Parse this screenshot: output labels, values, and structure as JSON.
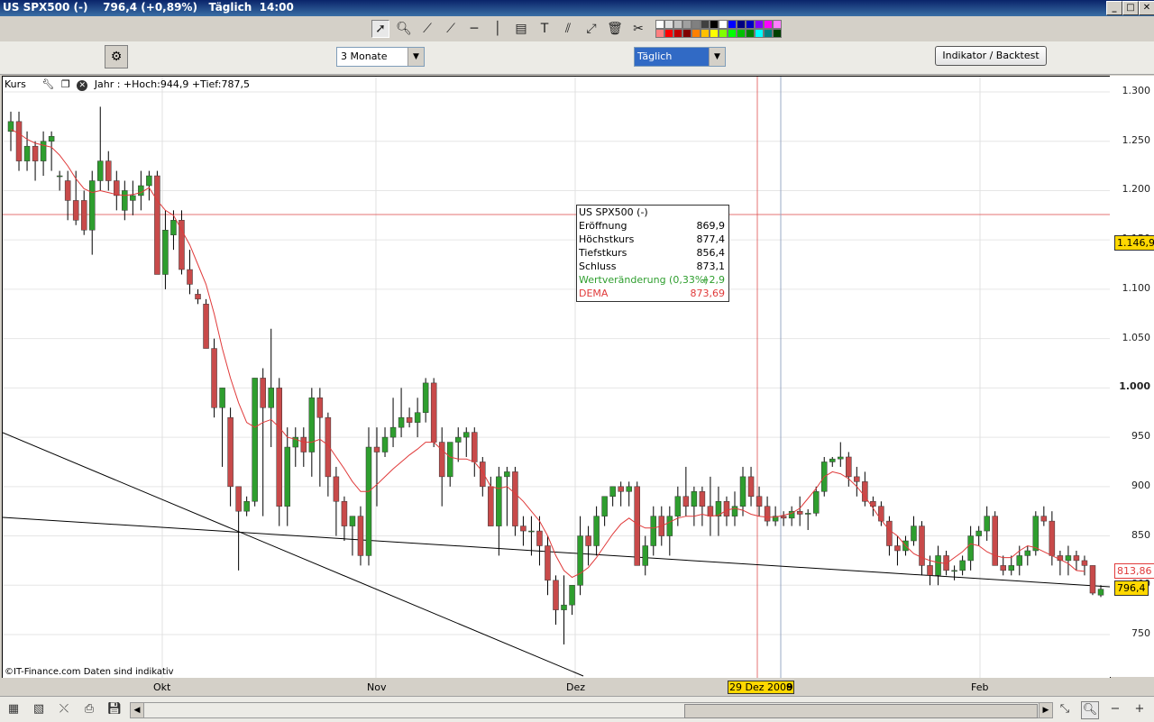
{
  "window": {
    "title": "US SPX500 (-)    796,4 (+0,89%)   Täglich  14:00"
  },
  "toolbar": {
    "icons": [
      "pointer-icon",
      "zoom-cursor-icon",
      "line-tool-icon",
      "trendline-icon",
      "horizontal-line-icon",
      "vertical-line-icon",
      "channel-icon",
      "text-tool-icon",
      "parallel-icon",
      "fibonacci-icon",
      "trash-icon",
      "tools-icon"
    ],
    "colors_row1": [
      "#ffffff",
      "#e0e0e0",
      "#c0c0c0",
      "#a0a0a0",
      "#808080",
      "#404040",
      "#000000",
      "#ffffff",
      "#0000ff",
      "#000080",
      "#0000c0",
      "#8000ff",
      "#ff00ff",
      "#ff80ff"
    ],
    "colors_row2": [
      "#ff8080",
      "#ff0000",
      "#c00000",
      "#800000",
      "#ff8000",
      "#ffc000",
      "#ffff00",
      "#80ff00",
      "#00ff00",
      "#00c000",
      "#008000",
      "#00ffff",
      "#008080",
      "#004000"
    ]
  },
  "controls": {
    "period": "3 Monate",
    "interval": "Täglich",
    "indicator_button": "Indikator / Backtest"
  },
  "chart_header": {
    "label": "Kurs",
    "range": "Jahr : +Hoch:944,9 +Tief:787,5"
  },
  "copyright": "©IT-Finance.com  Daten sind indikativ",
  "info": {
    "title": "US SPX500 (-)",
    "rows": [
      {
        "k": "Eröffnung",
        "v": "869,9"
      },
      {
        "k": "Höchstkurs",
        "v": "877,4"
      },
      {
        "k": "Tiefstkurs",
        "v": "856,4"
      },
      {
        "k": "Schluss",
        "v": "873,1"
      },
      {
        "k": "Wertveränderung (0,33%)",
        "v": "+2,9"
      },
      {
        "k": "DEMA",
        "v": "873,69"
      }
    ]
  },
  "axis": {
    "ticks": [
      "1.300",
      "1.250",
      "1.200",
      "1.150",
      "1.100",
      "1.050",
      "1.000",
      "950",
      "900",
      "850",
      "800",
      "750"
    ],
    "crosshair_value": "1.146,9",
    "dema_value": "813,86",
    "last_value": "796,4"
  },
  "x_axis": {
    "labels": [
      "Okt",
      "Nov",
      "Dez",
      "Feb"
    ],
    "cursor_date": "29 Dez 2008",
    "cursor_suffix": "9"
  },
  "chart_data": {
    "type": "candlestick",
    "ylim": [
      730,
      1310
    ],
    "colors": {
      "up": "#2e9e2e",
      "down": "#c84a4a",
      "dema": "#e03a3a",
      "crosshair": "#e05050",
      "yellow": "#ffd800"
    },
    "candles": [
      [
        1260,
        1280,
        1240,
        1270
      ],
      [
        1270,
        1280,
        1220,
        1230
      ],
      [
        1230,
        1260,
        1220,
        1245
      ],
      [
        1245,
        1250,
        1210,
        1230
      ],
      [
        1230,
        1260,
        1215,
        1250
      ],
      [
        1250,
        1260,
        1220,
        1255
      ],
      [
        1215,
        1220,
        1200,
        1215
      ],
      [
        1210,
        1220,
        1170,
        1190
      ],
      [
        1190,
        1220,
        1165,
        1170
      ],
      [
        1190,
        1200,
        1155,
        1160
      ],
      [
        1160,
        1220,
        1135,
        1210
      ],
      [
        1210,
        1285,
        1200,
        1230
      ],
      [
        1230,
        1240,
        1200,
        1210
      ],
      [
        1210,
        1220,
        1180,
        1195
      ],
      [
        1180,
        1210,
        1170,
        1200
      ],
      [
        1190,
        1210,
        1175,
        1195
      ],
      [
        1195,
        1220,
        1180,
        1205
      ],
      [
        1205,
        1220,
        1190,
        1215
      ],
      [
        1215,
        1220,
        1120,
        1115
      ],
      [
        1115,
        1180,
        1100,
        1160
      ],
      [
        1155,
        1180,
        1140,
        1170
      ],
      [
        1170,
        1180,
        1115,
        1120
      ],
      [
        1120,
        1140,
        1095,
        1105
      ],
      [
        1095,
        1100,
        1085,
        1090
      ],
      [
        1085,
        1090,
        1040,
        1040
      ],
      [
        1040,
        1050,
        970,
        980
      ],
      [
        980,
        1000,
        920,
        1000
      ],
      [
        970,
        980,
        880,
        900
      ],
      [
        900,
        890,
        815,
        875
      ],
      [
        875,
        890,
        870,
        885
      ],
      [
        885,
        1010,
        880,
        1010
      ],
      [
        1010,
        1020,
        870,
        980
      ],
      [
        980,
        1060,
        940,
        1000
      ],
      [
        1000,
        1010,
        860,
        880
      ],
      [
        880,
        960,
        860,
        940
      ],
      [
        940,
        960,
        920,
        950
      ],
      [
        950,
        960,
        920,
        935
      ],
      [
        935,
        1000,
        910,
        990
      ],
      [
        990,
        1000,
        900,
        970
      ],
      [
        970,
        975,
        890,
        910
      ],
      [
        910,
        920,
        850,
        885
      ],
      [
        885,
        890,
        845,
        860
      ],
      [
        860,
        870,
        830,
        870
      ],
      [
        870,
        880,
        820,
        830
      ],
      [
        830,
        960,
        820,
        940
      ],
      [
        940,
        960,
        880,
        935
      ],
      [
        935,
        960,
        930,
        950
      ],
      [
        950,
        990,
        940,
        960
      ],
      [
        960,
        1000,
        950,
        970
      ],
      [
        970,
        980,
        960,
        965
      ],
      [
        965,
        990,
        950,
        975
      ],
      [
        975,
        1010,
        965,
        1005
      ],
      [
        1005,
        1010,
        940,
        945
      ],
      [
        945,
        960,
        880,
        910
      ],
      [
        910,
        940,
        900,
        945
      ],
      [
        945,
        960,
        925,
        950
      ],
      [
        950,
        960,
        930,
        955
      ],
      [
        955,
        960,
        910,
        925
      ],
      [
        925,
        930,
        890,
        900
      ],
      [
        900,
        910,
        860,
        860
      ],
      [
        860,
        920,
        830,
        910
      ],
      [
        910,
        920,
        860,
        915
      ],
      [
        915,
        920,
        850,
        860
      ],
      [
        860,
        870,
        840,
        855
      ],
      [
        855,
        870,
        830,
        855
      ],
      [
        855,
        870,
        820,
        840
      ],
      [
        840,
        850,
        790,
        805
      ],
      [
        805,
        810,
        760,
        775
      ],
      [
        775,
        810,
        740,
        780
      ],
      [
        780,
        800,
        770,
        800
      ],
      [
        800,
        870,
        790,
        850
      ],
      [
        850,
        860,
        820,
        840
      ],
      [
        840,
        880,
        830,
        870
      ],
      [
        870,
        890,
        860,
        890
      ],
      [
        890,
        900,
        880,
        900
      ],
      [
        900,
        905,
        880,
        895
      ],
      [
        895,
        905,
        880,
        900
      ],
      [
        900,
        905,
        820,
        820
      ],
      [
        820,
        850,
        810,
        840
      ],
      [
        840,
        880,
        830,
        870
      ],
      [
        870,
        880,
        840,
        850
      ],
      [
        850,
        880,
        830,
        870
      ],
      [
        870,
        900,
        860,
        890
      ],
      [
        890,
        920,
        870,
        880
      ],
      [
        880,
        900,
        860,
        895
      ],
      [
        895,
        900,
        860,
        880
      ],
      [
        880,
        910,
        850,
        870
      ],
      [
        870,
        900,
        850,
        885
      ],
      [
        885,
        890,
        860,
        870
      ],
      [
        870,
        895,
        860,
        880
      ],
      [
        880,
        920,
        870,
        910
      ],
      [
        910,
        920,
        880,
        890
      ],
      [
        890,
        900,
        870,
        880
      ],
      [
        880,
        890,
        860,
        865
      ],
      [
        865,
        880,
        860,
        870
      ],
      [
        870,
        875,
        860,
        868
      ],
      [
        868,
        880,
        860,
        875
      ],
      [
        875,
        890,
        860,
        872
      ],
      [
        872,
        877,
        856,
        873
      ],
      [
        873,
        900,
        870,
        895
      ],
      [
        895,
        930,
        890,
        925
      ],
      [
        925,
        930,
        920,
        928
      ],
      [
        928,
        945,
        920,
        930
      ],
      [
        930,
        935,
        900,
        910
      ],
      [
        910,
        920,
        890,
        905
      ],
      [
        905,
        915,
        880,
        885
      ],
      [
        885,
        890,
        870,
        880
      ],
      [
        880,
        885,
        860,
        865
      ],
      [
        865,
        870,
        830,
        840
      ],
      [
        840,
        850,
        820,
        835
      ],
      [
        835,
        850,
        830,
        845
      ],
      [
        845,
        870,
        840,
        860
      ],
      [
        860,
        865,
        810,
        820
      ],
      [
        820,
        830,
        800,
        810
      ],
      [
        810,
        840,
        800,
        830
      ],
      [
        830,
        835,
        810,
        815
      ],
      [
        815,
        820,
        805,
        815
      ],
      [
        815,
        830,
        810,
        825
      ],
      [
        825,
        860,
        815,
        850
      ],
      [
        850,
        860,
        840,
        855
      ],
      [
        855,
        880,
        845,
        870
      ],
      [
        870,
        875,
        820,
        820
      ],
      [
        820,
        830,
        810,
        815
      ],
      [
        815,
        830,
        810,
        820
      ],
      [
        820,
        840,
        810,
        830
      ],
      [
        830,
        840,
        820,
        835
      ],
      [
        835,
        875,
        830,
        870
      ],
      [
        870,
        880,
        860,
        865
      ],
      [
        865,
        875,
        820,
        830
      ],
      [
        830,
        835,
        810,
        825
      ],
      [
        825,
        840,
        810,
        830
      ],
      [
        830,
        835,
        815,
        825
      ],
      [
        825,
        830,
        810,
        820
      ],
      [
        820,
        820,
        790,
        792
      ],
      [
        790,
        800,
        788,
        796
      ]
    ],
    "dema": [
      1262,
      1258,
      1252,
      1248,
      1246,
      1244,
      1236,
      1225,
      1212,
      1202,
      1198,
      1200,
      1198,
      1196,
      1195,
      1196,
      1198,
      1203,
      1190,
      1180,
      1175,
      1160,
      1145,
      1125,
      1105,
      1075,
      1040,
      1010,
      985,
      965,
      960,
      965,
      968,
      960,
      950,
      948,
      945,
      945,
      948,
      942,
      930,
      918,
      905,
      895,
      895,
      902,
      910,
      918,
      925,
      932,
      938,
      945,
      945,
      937,
      930,
      928,
      928,
      925,
      915,
      900,
      898,
      900,
      893,
      885,
      875,
      865,
      850,
      830,
      815,
      808,
      812,
      818,
      828,
      840,
      852,
      862,
      868,
      862,
      858,
      858,
      860,
      864,
      868,
      870,
      870,
      872,
      870,
      871,
      876,
      878,
      876,
      872,
      870,
      869,
      869,
      871,
      873,
      878,
      888,
      898,
      910,
      915,
      913,
      908,
      900,
      890,
      878,
      866,
      856,
      850,
      840,
      832,
      828,
      825,
      823,
      822,
      828,
      834,
      842,
      840,
      834,
      830,
      828,
      828,
      835,
      840,
      838,
      834,
      830,
      826,
      822,
      815,
      814
    ],
    "date_labels": [
      "Okt",
      "Nov",
      "Dez",
      "Feb"
    ]
  }
}
